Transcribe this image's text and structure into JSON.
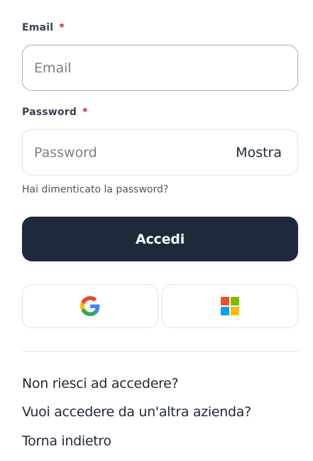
{
  "email": {
    "label": "Email",
    "required_mark": "*",
    "placeholder": "Email",
    "value": ""
  },
  "password": {
    "label": "Password",
    "required_mark": "*",
    "placeholder": "Password",
    "value": "",
    "show_label": "Mostra"
  },
  "forgot_password": "Hai dimenticato la password?",
  "submit_label": "Accedi",
  "sso": {
    "google_icon": "google-icon",
    "microsoft_icon": "microsoft-icon"
  },
  "links": {
    "cannot_login": "Non riesci ad accedere?",
    "other_company": "Vuoi accedere da un'altra azienda?",
    "go_back": "Torna indietro"
  },
  "colors": {
    "primary_button": "#1e293b",
    "required": "#c0262d",
    "text": "#1f2937"
  }
}
